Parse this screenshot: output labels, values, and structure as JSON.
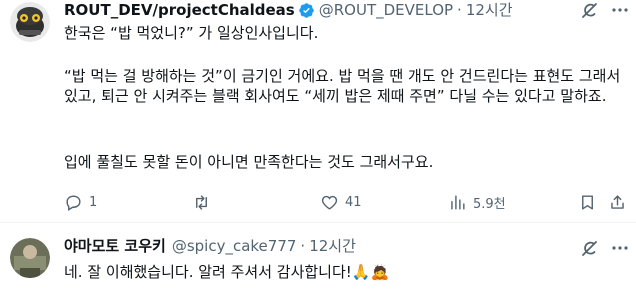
{
  "tweet1": {
    "name": "ROUT_DEV/projectChaldeas",
    "handle": "@ROUT_DEVELOP",
    "dot": "·",
    "time": "12시간",
    "para1": "한국은 “밥 먹었니?” 가 일상인사입니다.",
    "para2": "“밥 먹는 걸 방해하는 것”이 금기인 거에요. 밥 먹을 땐 개도 안 건드린다는 표현도 그래서 있고, 퇴근 안 시켜주는 블랙 회사여도 “세끼 밥은 제때 주면” 다닐 수는 있다고 말하죠.",
    "para3": "입에 풀칠도 못할 돈이 아니면 만족한다는 것도 그래서구요.",
    "reply_count": "1",
    "retweet_count": "",
    "like_count": "41",
    "view_count": "5.9천"
  },
  "tweet2": {
    "name": "야마모토 코우키",
    "handle": "@spicy_cake777",
    "dot": "·",
    "time": "12시간",
    "text": "네. 잘 이해했습니다. 알려 주셔서 감사합니다!🙏🙇"
  },
  "colors": {
    "text": "#0f1419",
    "secondary": "#536471",
    "verified": "#1d9bf0",
    "divider": "#eff3f4"
  },
  "icons": [
    "reply-icon",
    "retweet-icon",
    "like-icon",
    "views-icon",
    "bookmark-icon",
    "share-icon",
    "grok-icon",
    "more-icon",
    "verified-badge-icon"
  ]
}
